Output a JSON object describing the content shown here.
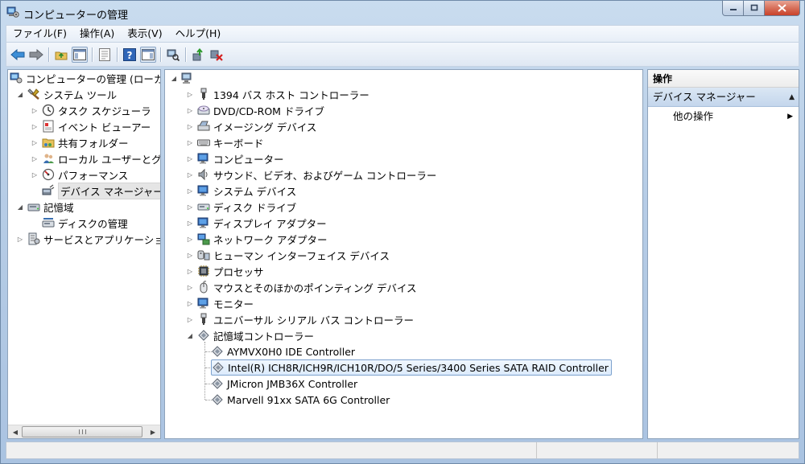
{
  "window": {
    "title": "コンピューターの管理"
  },
  "menu": [
    "ファイル(F)",
    "操作(A)",
    "表示(V)",
    "ヘルプ(H)"
  ],
  "left_tree": [
    {
      "label": "コンピューターの管理 (ローカ",
      "icon": "computer-management-icon",
      "toggle": "none"
    },
    {
      "label": "システム ツール",
      "icon": "system-tools-icon",
      "toggle": "expanded"
    },
    {
      "label": "タスク スケジューラ",
      "icon": "clock-icon",
      "toggle": "collapsed"
    },
    {
      "label": "イベント ビューアー",
      "icon": "event-viewer-icon",
      "toggle": "collapsed"
    },
    {
      "label": "共有フォルダー",
      "icon": "shared-folder-icon",
      "toggle": "collapsed"
    },
    {
      "label": "ローカル ユーザーとグ",
      "icon": "users-icon",
      "toggle": "collapsed"
    },
    {
      "label": "パフォーマンス",
      "icon": "performance-icon",
      "toggle": "collapsed"
    },
    {
      "label": "デバイス マネージャー",
      "icon": "device-manager-icon",
      "toggle": "none",
      "selected": true
    },
    {
      "label": "記憶域",
      "icon": "storage-icon",
      "toggle": "expanded"
    },
    {
      "label": "ディスクの管理",
      "icon": "disk-management-icon",
      "toggle": "none"
    },
    {
      "label": "サービスとアプリケーショ",
      "icon": "services-icon",
      "toggle": "collapsed"
    }
  ],
  "device_tree": {
    "root_icon": "computer-icon",
    "categories": [
      {
        "label": "1394 バス ホスト コントローラー",
        "icon": "usb-plug-icon"
      },
      {
        "label": "DVD/CD-ROM ドライブ",
        "icon": "dvd-drive-icon"
      },
      {
        "label": "イメージング デバイス",
        "icon": "scanner-icon"
      },
      {
        "label": "キーボード",
        "icon": "keyboard-icon"
      },
      {
        "label": "コンピューター",
        "icon": "monitor-icon"
      },
      {
        "label": "サウンド、ビデオ、およびゲーム コントローラー",
        "icon": "speaker-icon"
      },
      {
        "label": "システム デバイス",
        "icon": "monitor-icon"
      },
      {
        "label": "ディスク ドライブ",
        "icon": "disk-drive-icon"
      },
      {
        "label": "ディスプレイ アダプター",
        "icon": "monitor-icon"
      },
      {
        "label": "ネットワーク アダプター",
        "icon": "network-icon"
      },
      {
        "label": "ヒューマン インターフェイス デバイス",
        "icon": "hid-icon"
      },
      {
        "label": "プロセッサ",
        "icon": "processor-icon"
      },
      {
        "label": "マウスとそのほかのポインティング デバイス",
        "icon": "mouse-icon"
      },
      {
        "label": "モニター",
        "icon": "monitor-icon"
      },
      {
        "label": "ユニバーサル シリアル バス コントローラー",
        "icon": "usb-plug-icon"
      },
      {
        "label": "記憶域コントローラー",
        "icon": "storage-controller-icon",
        "expanded": true
      }
    ],
    "storage_controllers": [
      "AYMVX0H0 IDE Controller",
      "Intel(R) ICH8R/ICH9R/ICH10R/DO/5 Series/3400 Series SATA RAID Controller",
      "JMicron JMB36X Controller",
      "Marvell 91xx SATA 6G Controller"
    ],
    "selected_index": 1
  },
  "actions": {
    "header": "操作",
    "section": "デバイス マネージャー",
    "item": "他の操作"
  }
}
